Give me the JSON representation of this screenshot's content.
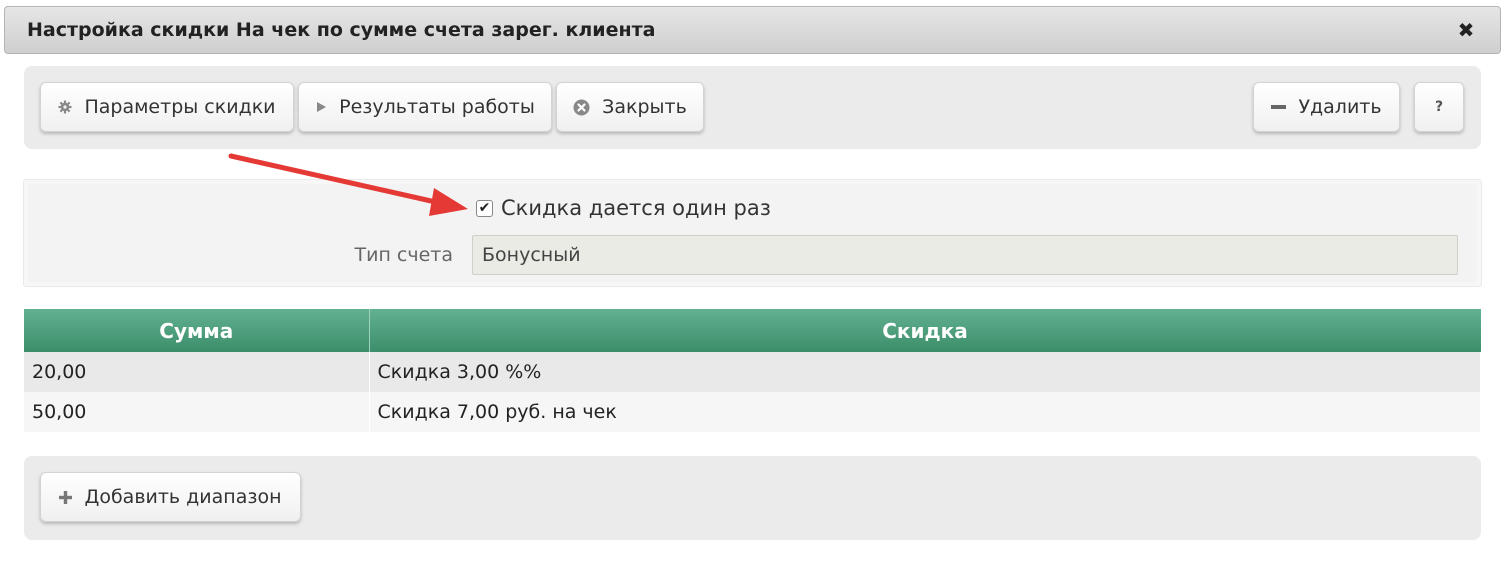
{
  "dialog": {
    "title": "Настройка скидки На чек по сумме счета зарег. клиента",
    "close_icon": "✖"
  },
  "toolbar": {
    "params_label": "Параметры скидки",
    "results_label": "Результаты работы",
    "close_label": "Закрыть",
    "delete_label": "Удалить",
    "help_label": "?"
  },
  "form": {
    "once_checked": true,
    "once_label": "Скидка дается один раз",
    "account_type_label": "Тип счета",
    "account_type_value": "Бонусный"
  },
  "table": {
    "headers": [
      "Сумма",
      "Скидка"
    ],
    "rows": [
      [
        "20,00",
        "Скидка 3,00 %%"
      ],
      [
        "50,00",
        "Скидка 7,00 руб. на чек"
      ]
    ]
  },
  "footer": {
    "add_range_label": "Добавить диапазон"
  },
  "colors": {
    "header_green": "#4ea37f",
    "arrow_red": "#e53935"
  },
  "icons": {
    "params": "gear-icon",
    "results": "play-icon",
    "close": "circle-x-icon",
    "delete": "minus-icon",
    "add": "plus-icon"
  }
}
